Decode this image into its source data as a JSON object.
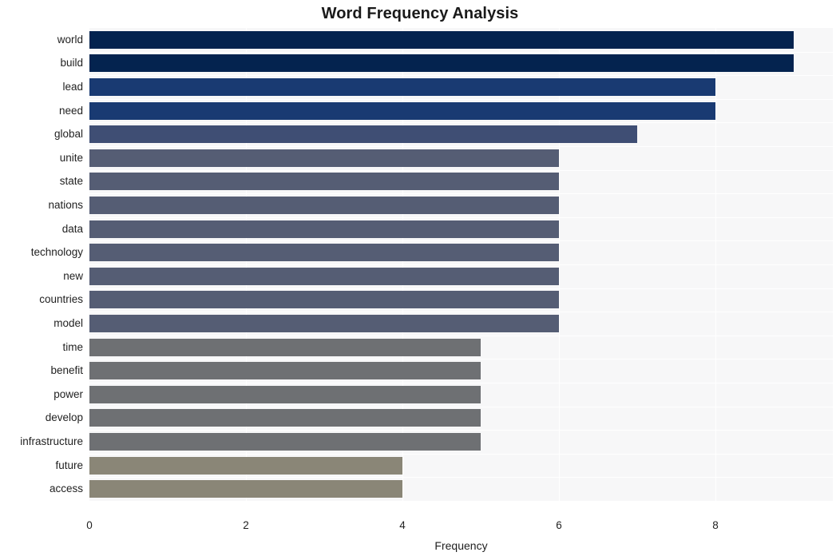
{
  "chart_data": {
    "type": "bar",
    "orientation": "horizontal",
    "title": "Word Frequency Analysis",
    "xlabel": "Frequency",
    "ylabel": "",
    "xlim": [
      0,
      9.5
    ],
    "xticks": [
      0,
      2,
      4,
      6,
      8
    ],
    "xtick_labels": [
      "0",
      "2",
      "4",
      "6",
      "8"
    ],
    "grid": true,
    "grid_axis": "x",
    "legend": "none",
    "plot_background": "#f7f7f8",
    "categories": [
      "world",
      "build",
      "lead",
      "need",
      "global",
      "unite",
      "state",
      "nations",
      "data",
      "technology",
      "new",
      "countries",
      "model",
      "time",
      "benefit",
      "power",
      "develop",
      "infrastructure",
      "future",
      "access"
    ],
    "values": [
      9,
      9,
      8,
      8,
      7,
      6,
      6,
      6,
      6,
      6,
      6,
      6,
      6,
      5,
      5,
      5,
      5,
      5,
      4,
      4
    ],
    "bar_colors": [
      "#04234f",
      "#04234f",
      "#193a72",
      "#193a72",
      "#3f4e74",
      "#555d74",
      "#555d74",
      "#555d74",
      "#555d74",
      "#555d74",
      "#555d74",
      "#555d74",
      "#555d74",
      "#6e7073",
      "#6e7073",
      "#6e7073",
      "#6e7073",
      "#6e7073",
      "#8a8677",
      "#8a8677"
    ]
  }
}
